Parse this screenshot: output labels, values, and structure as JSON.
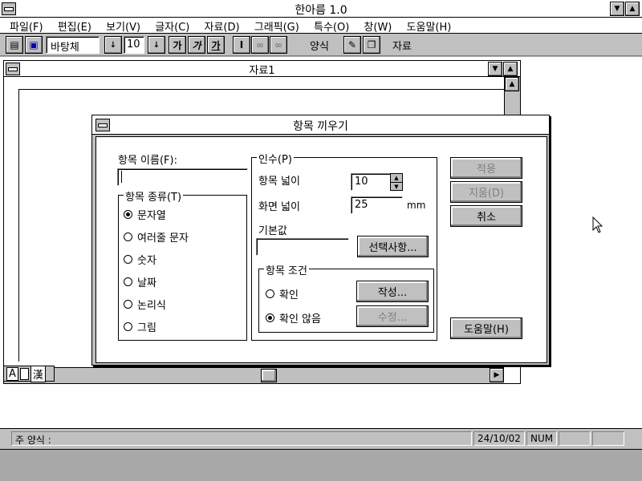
{
  "app": {
    "title": "한아름 1.0"
  },
  "menu": [
    "파일(F)",
    "편집(E)",
    "보기(V)",
    "글자(C)",
    "자료(D)",
    "그래픽(G)",
    "특수(O)",
    "창(W)",
    "도움말(H)"
  ],
  "toolbar": {
    "font_name": "바탕체",
    "font_size": "10",
    "style_buttons": [
      "가",
      "가",
      "가"
    ],
    "style_label": "양식",
    "data_label": "자료"
  },
  "document": {
    "title": "자료1"
  },
  "dialog": {
    "title": "항목 끼우기",
    "name_label": "항목 이름(F):",
    "name_value": "",
    "type_group": "항목 종류(T)",
    "types": [
      {
        "label": "문자열",
        "checked": true
      },
      {
        "label": "여러줄 문자",
        "checked": false
      },
      {
        "label": "숫자",
        "checked": false
      },
      {
        "label": "날짜",
        "checked": false
      },
      {
        "label": "논리식",
        "checked": false
      },
      {
        "label": "그림",
        "checked": false
      }
    ],
    "args_group": "인수(P)",
    "width_label": "항목 넓이",
    "width_value": "10",
    "screen_width_label": "화면 넓이",
    "screen_width_value": "25",
    "screen_width_unit": "mm",
    "default_label": "기본값",
    "default_value": "",
    "select_button": "선택사항...",
    "cond_group": "항목 조건",
    "cond_options": [
      {
        "label": "확인",
        "checked": false
      },
      {
        "label": "확인 않음",
        "checked": true
      }
    ],
    "write_button": "작성...",
    "edit_button": "수정...",
    "apply_button": "적용",
    "apply_d_button": "지움(D)",
    "cancel_button": "취소",
    "help_button": "도움말(H)"
  },
  "ime": {
    "mode": "A",
    "han": "漢"
  },
  "status": {
    "style": "주 양식 :",
    "date": "24/10/02",
    "num": "NUM"
  }
}
